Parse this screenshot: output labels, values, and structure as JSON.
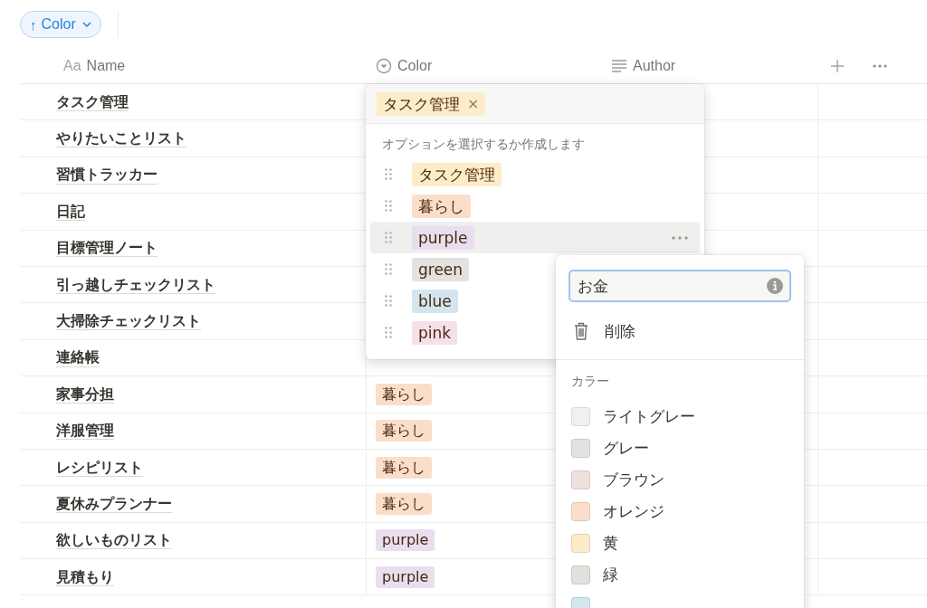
{
  "toolbar": {
    "sort_chip": {
      "arrow": "↑",
      "label": "Color"
    }
  },
  "table": {
    "columns": [
      {
        "kind": "title",
        "prefix": "Aa",
        "label": "Name"
      },
      {
        "kind": "select",
        "label": "Color"
      },
      {
        "kind": "text",
        "label": "Author"
      }
    ],
    "rows": [
      {
        "name": "タスク管理"
      },
      {
        "name": "やりたいことリスト"
      },
      {
        "name": "習慣トラッカー"
      },
      {
        "name": "日記"
      },
      {
        "name": "目標管理ノート"
      },
      {
        "name": "引っ越しチェックリスト"
      },
      {
        "name": "大掃除チェックリスト"
      },
      {
        "name": "連絡帳"
      },
      {
        "name": "家事分担",
        "tag": {
          "label": "暮らし",
          "color": "#fadec9"
        }
      },
      {
        "name": "洋服管理",
        "tag": {
          "label": "暮らし",
          "color": "#fadec9"
        }
      },
      {
        "name": "レシピリスト",
        "tag": {
          "label": "暮らし",
          "color": "#fadec9"
        }
      },
      {
        "name": "夏休みプランナー",
        "tag": {
          "label": "暮らし",
          "color": "#fadec9"
        }
      },
      {
        "name": "欲しいものリスト",
        "tag": {
          "label": "purple",
          "color": "#e8deee"
        }
      },
      {
        "name": "見積もり",
        "tag": {
          "label": "purple",
          "color": "#e8deee"
        }
      }
    ]
  },
  "select_popup": {
    "selected_tag": {
      "label": "タスク管理",
      "color": "#fdecc8",
      "remove": "×"
    },
    "hint": "オプションを選択するか作成します",
    "options": [
      {
        "label": "タスク管理",
        "color": "#fdecc8",
        "selected": false
      },
      {
        "label": "暮らし",
        "color": "#fadec9",
        "selected": false
      },
      {
        "label": "purple",
        "color": "#e8deee",
        "selected": true
      },
      {
        "label": "green",
        "color": "#e3e2e0",
        "selected": false
      },
      {
        "label": "blue",
        "color": "#d3e5ef",
        "selected": false
      },
      {
        "label": "pink",
        "color": "#f5e0e9",
        "selected": false
      }
    ]
  },
  "option_menu": {
    "name_field": {
      "value": "お金"
    },
    "delete": "削除",
    "color_heading": "カラー",
    "colors": [
      {
        "label": "ライトグレー",
        "color": "#f1f1ef"
      },
      {
        "label": "グレー",
        "color": "#e3e2e0"
      },
      {
        "label": "ブラウン",
        "color": "#eee0da"
      },
      {
        "label": "オレンジ",
        "color": "#fadec9"
      },
      {
        "label": "黄",
        "color": "#fdecc8"
      },
      {
        "label": "緑",
        "color": "#dfe1dc"
      },
      {
        "color": "#d3e5ef"
      }
    ]
  }
}
